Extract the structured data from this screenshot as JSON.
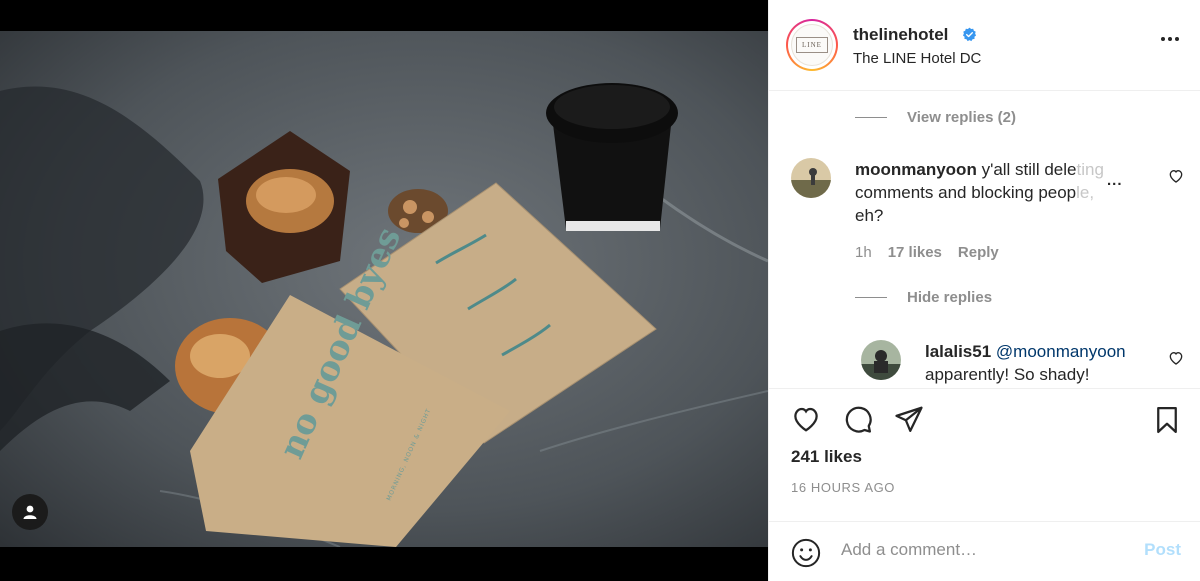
{
  "post": {
    "username": "thelinehotel",
    "location": "The LINE Hotel DC",
    "logo_text": "LINE",
    "photo_bag_text": "no good byes",
    "photo_bag_subtext": "MORNING, NOON & NIGHT"
  },
  "comments": {
    "view_replies": "View replies (2)",
    "hide_replies": "Hide replies",
    "main": {
      "user": "moonmanyoon",
      "text_visible": "y'all still dele",
      "text_faded": "ting",
      "line2_visible": "comments and blocking peop",
      "line2_faded": "le,",
      "line3": "eh?",
      "dots": "...",
      "time": "1h",
      "likes": "17 likes",
      "reply": "Reply"
    },
    "reply": {
      "user": "lalalis51",
      "mention": "@moonmanyoon",
      "text": "apparently! So shady!"
    }
  },
  "actions": {
    "likes": "241 likes",
    "time_ago": "16 HOURS AGO"
  },
  "composer": {
    "placeholder": "Add a comment…",
    "post_label": "Post"
  },
  "icons": [
    "verified-badge-icon",
    "more-options-icon",
    "heart-icon",
    "comment-icon",
    "share-icon",
    "bookmark-icon",
    "emoji-icon",
    "user-tag-icon"
  ],
  "colors": {
    "verified": "#3897f0",
    "post_disabled": "#b2dffc",
    "secondary_text": "#8e8e8e",
    "mention": "#00376b"
  }
}
